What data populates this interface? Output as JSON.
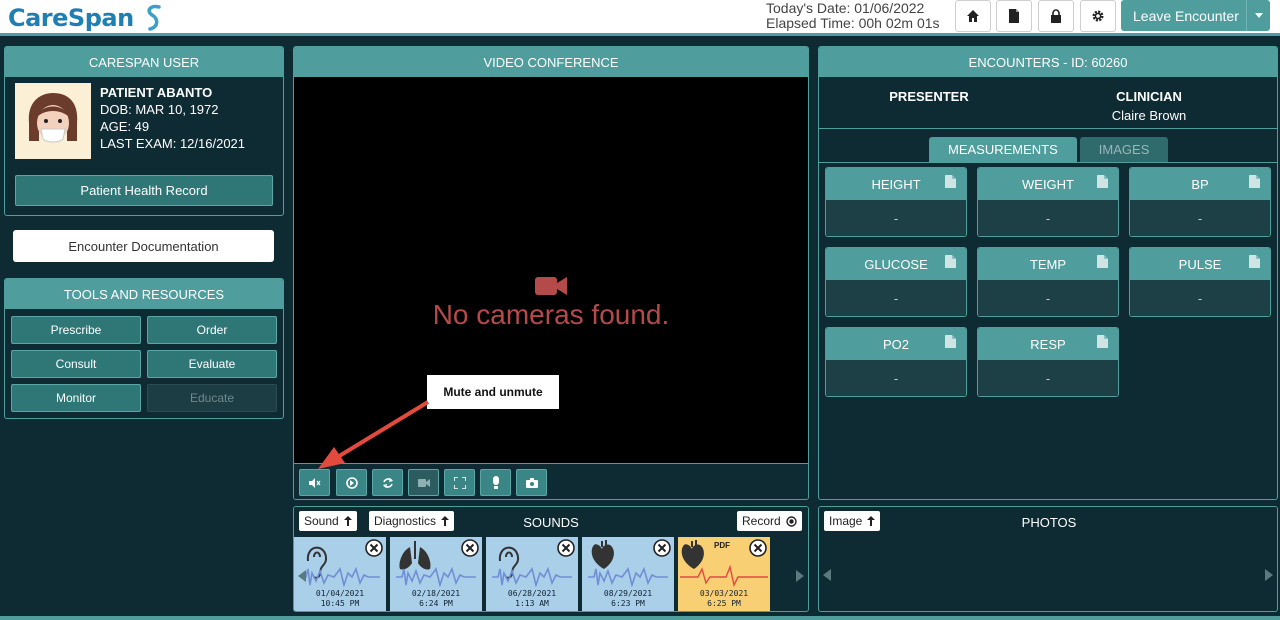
{
  "header": {
    "logo_text": "CareSpan",
    "today_date": "Today's Date: 01/06/2022",
    "elapsed_time": "Elapsed Time: 00h 02m 01s",
    "leave_label": "Leave Encounter",
    "icons": [
      "home-icon",
      "document-icon",
      "lock-icon",
      "gear-icon",
      "caret-down-icon"
    ]
  },
  "user_panel": {
    "title": "CARESPAN USER",
    "patient_name": "PATIENT ABANTO",
    "dob": "DOB: MAR 10, 1972",
    "age": "AGE: 49",
    "last_exam": "LAST EXAM: 12/16/2021",
    "phr_button": "Patient Health Record"
  },
  "encounter_doc_button": "Encounter Documentation",
  "tools": {
    "title": "TOOLS AND RESOURCES",
    "buttons": [
      {
        "label": "Prescribe",
        "enabled": true
      },
      {
        "label": "Order",
        "enabled": true
      },
      {
        "label": "Consult",
        "enabled": true
      },
      {
        "label": "Evaluate",
        "enabled": true
      },
      {
        "label": "Monitor",
        "enabled": true
      },
      {
        "label": "Educate",
        "enabled": false
      }
    ]
  },
  "video": {
    "title": "VIDEO CONFERENCE",
    "no_camera": "No cameras found.",
    "callout": "Mute and unmute",
    "controls": [
      "mute-icon",
      "switch-audio-icon",
      "refresh-icon",
      "camera-icon",
      "fullscreen-icon",
      "bulb-icon",
      "snapshot-icon"
    ]
  },
  "encounters": {
    "title": "ENCOUNTERS - ID: 60260",
    "presenter_label": "PRESENTER",
    "clinician_label": "CLINICIAN",
    "clinician_name": "Claire Brown",
    "tabs": [
      {
        "label": "MEASUREMENTS",
        "active": true
      },
      {
        "label": "IMAGES",
        "active": false
      }
    ],
    "measurements": [
      {
        "label": "HEIGHT",
        "value": "-"
      },
      {
        "label": "WEIGHT",
        "value": "-"
      },
      {
        "label": "BP",
        "value": "-"
      },
      {
        "label": "GLUCOSE",
        "value": "-"
      },
      {
        "label": "TEMP",
        "value": "-"
      },
      {
        "label": "PULSE",
        "value": "-"
      },
      {
        "label": "PO2",
        "value": "-"
      },
      {
        "label": "RESP",
        "value": "-"
      }
    ]
  },
  "sounds": {
    "title": "SOUNDS",
    "sound_button": "Sound",
    "diagnostics_button": "Diagnostics",
    "record_button": "Record",
    "items": [
      {
        "icon": "ear-icon",
        "date": "01/04/2021",
        "time": "10:45 PM",
        "type": "audio"
      },
      {
        "icon": "lungs-icon",
        "date": "02/18/2021",
        "time": "6:24 PM",
        "type": "audio"
      },
      {
        "icon": "ear-icon",
        "date": "06/28/2021",
        "time": "1:13 AM",
        "type": "audio"
      },
      {
        "icon": "heart-icon",
        "date": "08/29/2021",
        "time": "6:23 PM",
        "type": "audio"
      },
      {
        "icon": "heart-icon",
        "date": "03/03/2021",
        "time": "6:25 PM",
        "type": "pdf",
        "badge": "PDF"
      }
    ]
  },
  "photos": {
    "title": "PHOTOS",
    "image_button": "Image"
  },
  "colors": {
    "teal": "#4f9d9d",
    "background": "#0e2b33",
    "alert_red": "#b44a4a",
    "sound_blue": "#a9cfe9",
    "pdf_yellow": "#f8cf73",
    "brand_blue": "#1f7fb3"
  }
}
